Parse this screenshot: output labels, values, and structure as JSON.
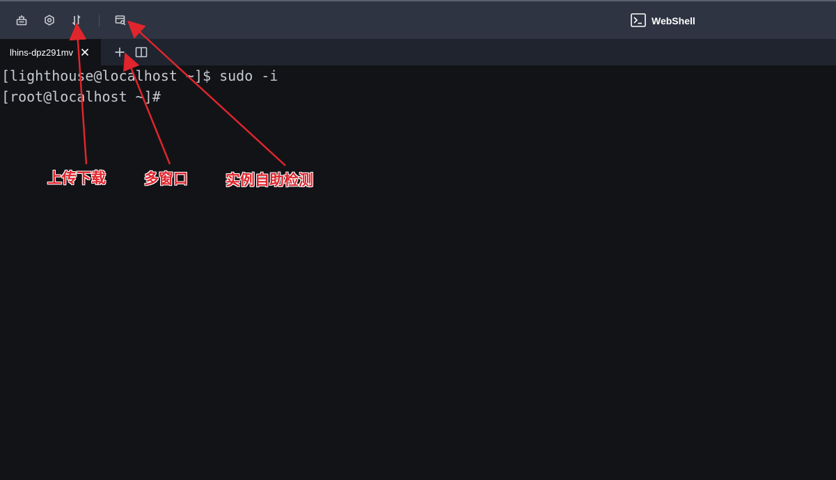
{
  "toolbar": {
    "buttons": [
      {
        "name": "server-icon"
      },
      {
        "name": "settings-icon"
      },
      {
        "name": "upload-download-icon"
      },
      {
        "name": "instance-check-icon"
      }
    ],
    "brand_label": "WebShell",
    "brand_icon": "terminal-icon"
  },
  "tabs": [
    {
      "label": "lhins-dpz291mv",
      "active": true
    }
  ],
  "tabbar_actions": {
    "add_icon": "plus-icon",
    "split_icon": "split-view-icon"
  },
  "terminal": {
    "lines": [
      "[lighthouse@localhost ~]$ sudo -i",
      "[root@localhost ~]#"
    ]
  },
  "annotations": {
    "upload_download": "上传下载",
    "multi_window": "多窗口",
    "instance_self_check": "实例自助检测"
  },
  "colors": {
    "toolbar_bg": "#2e3441",
    "tabbar_bg": "#1f242f",
    "terminal_bg": "#121317",
    "terminal_text": "#c7cad1",
    "annotation_red": "#e0252d"
  }
}
